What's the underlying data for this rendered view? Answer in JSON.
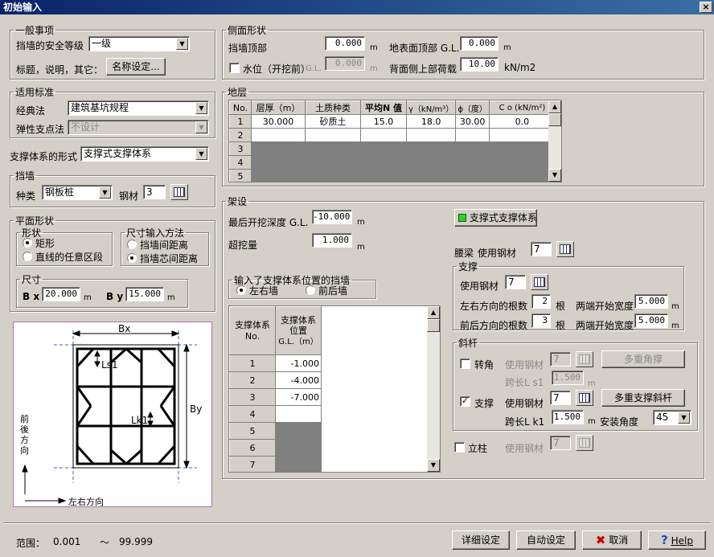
{
  "window": {
    "title": "初始输入",
    "close": "×"
  },
  "general": {
    "legend": "一般事项",
    "safety_label": "挡墙的安全等级",
    "safety_value": "一级",
    "title_label": "标题，说明，其它：",
    "name_btn": "名称设定..."
  },
  "standard": {
    "legend": "适用标准",
    "classic_label": "经典法",
    "classic_value": "建筑基坑规程",
    "elastic_label": "弹性支点法",
    "elastic_value": "不设计"
  },
  "support": {
    "label": "支撑体系的形式",
    "value": "支撑式支撑体系"
  },
  "wall": {
    "legend": "挡墙",
    "kind_label": "种类",
    "kind_value": "钢板桩",
    "steel_label": "钢材",
    "steel_value": "3"
  },
  "plan": {
    "legend": "平面形状",
    "shape_legend": "形状",
    "shape_rect": "矩形",
    "shape_any": "直线的任意区段",
    "method_legend": "尺寸输入方法",
    "method_between": "挡墙间距离",
    "method_core": "挡墙芯间距离",
    "size_legend": "尺寸",
    "bx_label": "B x",
    "bx_value": "20.000",
    "by_label": "B y",
    "by_value": "15.000",
    "unit_m": "m"
  },
  "diagram": {
    "bx": "Bx",
    "by": "By",
    "ls1": "Ls1",
    "lk1": "Lk1",
    "front_back": [
      "前",
      "後",
      "方",
      "向"
    ],
    "left_right": "左右方向"
  },
  "side": {
    "legend": "侧面形状",
    "top_label": "挡墙顶部",
    "top_value": "0.000",
    "unit_m": "m",
    "ground_label": "地表面顶部 G.L.",
    "ground_value": "0.000",
    "water_label": "水位（开挖前）",
    "water_gl": "G.L.",
    "water_value": "0.000",
    "load_label": "背面侧上部荷载",
    "load_value": "10.00",
    "load_unit": "kN/m2"
  },
  "strata": {
    "legend": "地层",
    "headers": [
      "No.",
      "层厚（m）",
      "土质种类",
      "平均N 值",
      "γ（kN/m³）",
      "ϕ（度）",
      "C o (kN/m²)"
    ],
    "rows": [
      [
        "1",
        "30.000",
        "砂质土",
        "15.0",
        "18.0",
        "30.00",
        "0.0"
      ],
      [
        "2",
        "",
        "",
        "",
        "",
        "",
        ""
      ],
      [
        "3",
        "",
        "",
        "",
        "",
        "",
        ""
      ],
      [
        "4",
        "",
        "",
        "",
        "",
        "",
        ""
      ],
      [
        "5",
        "",
        "",
        "",
        "",
        "",
        ""
      ]
    ]
  },
  "erect": {
    "legend": "架设",
    "depth_label": "最后开挖深度 G.L.",
    "depth_value": "-10.000",
    "over_label": "超挖量",
    "over_value": "1.000",
    "unit_m": "m",
    "input_legend": "输入了支撑体系位置的挡墙",
    "radio_lr": "左右墙",
    "radio_fb": "前后墙",
    "col1": "支撑体系 No.",
    "col2_a": "支撑体系",
    "col2_b": "位置",
    "col2_c": "G.L.（m）",
    "rows": [
      [
        "1",
        "-1.000"
      ],
      [
        "2",
        "-4.000"
      ],
      [
        "3",
        "-7.000"
      ],
      [
        "4",
        ""
      ],
      [
        "5",
        ""
      ],
      [
        "6",
        ""
      ],
      [
        "7",
        ""
      ]
    ],
    "system_btn": "支撑式支撑体系",
    "waling_label": "腰梁",
    "waling_use": "使用钢材",
    "waling_value": "7"
  },
  "strut": {
    "legend": "支撑",
    "use_label": "使用钢材",
    "use_value": "7",
    "lr_label": "左右方向的根数",
    "lr_value": "2",
    "fb_label": "前后方向的根数",
    "fb_value": "3",
    "gen": "根",
    "width_label": "两端开始宽度",
    "lr_width": "5.000",
    "fb_width": "5.000",
    "unit_m": "m"
  },
  "brace": {
    "legend": "斜杆",
    "corner_label": "转角",
    "corner_use": "使用钢材",
    "corner_value": "7",
    "corner_btn": "多重角撑",
    "span_ls_label": "跨长L s1",
    "span_ls_value": "1.500",
    "strut_label": "支撑",
    "strut_use": "使用钢材",
    "strut_value": "7",
    "strut_btn": "多重支撑斜杆",
    "span_lk_label": "跨长L k1",
    "span_lk_value": "1.500",
    "angle_label": "安装角度",
    "angle_value": "45",
    "unit_m": "m",
    "check": "✓"
  },
  "column": {
    "label": "立柱",
    "use": "使用钢材",
    "value": "7"
  },
  "footer": {
    "range_label": "范围：",
    "min": "0.001",
    "tilde": "～",
    "max": "99.999",
    "detail_btn": "详细设定",
    "auto_btn": "自动设定",
    "cancel_btn": "取消",
    "help_btn": "Help"
  }
}
